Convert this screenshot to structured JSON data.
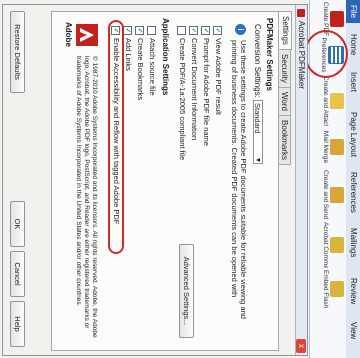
{
  "ribbon": {
    "tabs": [
      "File",
      "Home",
      "Insert",
      "Page Layout",
      "References",
      "Mailings",
      "Review",
      "View"
    ],
    "buttons": [
      {
        "label": "Create PDF",
        "icon": "pdf-icon"
      },
      {
        "label": "Preferences",
        "icon": "preferences-icon"
      },
      {
        "label": "Create and Attach to Email",
        "icon": "email-attach-icon"
      },
      {
        "label": "Mail Merge",
        "icon": "mail-merge-icon"
      },
      {
        "label": "Create and Send For Review",
        "icon": "send-review-icon"
      },
      {
        "label": "Acrobat Comments",
        "icon": "comments-icon"
      },
      {
        "label": "Embed Flash",
        "icon": "flash-icon"
      }
    ]
  },
  "dialog": {
    "title": "Acrobat PDFMaker",
    "close": "x",
    "tabs": [
      "Settings",
      "Security",
      "Word",
      "Bookmarks"
    ],
    "pdfmaker_settings": "PDFMaker Settings",
    "conversion_settings_label": "Conversion Settings:",
    "conversion_settings_value": "Standard",
    "description": "Use these settings to create Adobe PDF documents suitable for reliable viewing and printing of business documents. Created PDF documents can be opened with",
    "options": [
      {
        "label": "View Adobe PDF result",
        "checked": true
      },
      {
        "label": "Prompt for Adobe PDF file name",
        "checked": true
      },
      {
        "label": "Convert Document Information",
        "checked": true
      },
      {
        "label": "Create PDF/A-1a:2005 compliant file",
        "checked": false
      }
    ],
    "advanced_settings": "Advanced Settings...",
    "application_settings": "Application Settings",
    "app_options": [
      {
        "label": "Attach source file",
        "checked": false
      },
      {
        "label": "Create Bookmarks",
        "checked": true
      },
      {
        "label": "Add Links",
        "checked": true
      },
      {
        "label": "Enable Accessibility and Reflow with tagged Adobe PDF",
        "checked": true
      }
    ],
    "copyright": "© 1987-2010 Adobe Systems Incorporated and its licensors. All rights reserved. Adobe, the Adobe logo, Acrobat, the Adobe PDF logo, PostScript, and Reader are either registered trademarks or trademarks of Adobe Systems Incorporated in the United States and/or other countries.",
    "logo_text": "Adobe",
    "restore_defaults": "Restore Defaults",
    "ok": "OK",
    "cancel": "Cancel",
    "help": "Help"
  },
  "colors": {
    "annotation": "#cc2a2a",
    "file_tab": "#2f63b6",
    "acrobat_red": "#c0231f"
  }
}
